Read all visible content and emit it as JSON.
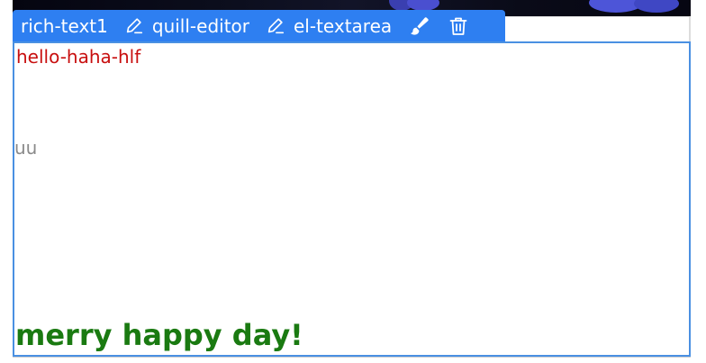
{
  "toolbar": {
    "title": "rich-text1",
    "quill_label": "quill-editor",
    "textarea_label": "el-textarea"
  },
  "icons": {
    "quill": "pencil-icon",
    "textarea": "pencil-icon",
    "brush": "brush-icon",
    "delete": "trash-icon"
  },
  "editor": {
    "line1": "hello-haha-hlf",
    "line2": "uu",
    "line3": "merry happy day!"
  },
  "colors": {
    "toolbar_bg": "#2e7ff1",
    "editor_border": "#4a90e2",
    "line1": "#c80f0f",
    "line2": "#8a8a8a",
    "line3": "#1a7a11"
  }
}
